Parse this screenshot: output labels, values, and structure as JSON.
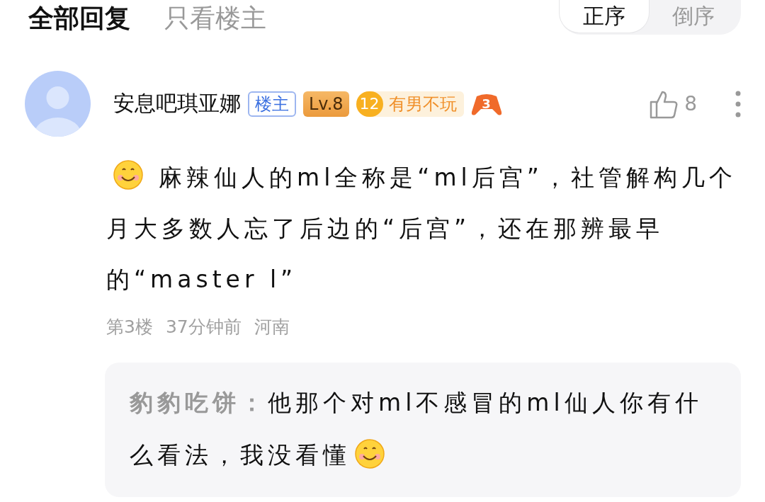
{
  "header": {
    "tabs": [
      {
        "label": "全部回复",
        "selected": true
      },
      {
        "label": "只看楼主",
        "selected": false
      }
    ],
    "sort": [
      {
        "label": "正序",
        "selected": true
      },
      {
        "label": "倒序",
        "selected": false
      }
    ]
  },
  "post": {
    "author": "安息吧琪亚娜",
    "badges": [
      {
        "kind": "role",
        "text": "楼主"
      },
      {
        "kind": "level",
        "text": "Lv.8"
      },
      {
        "kind": "fan",
        "number": "12",
        "text": "有男不玩"
      },
      {
        "kind": "game",
        "text": "3"
      }
    ],
    "likes": "8",
    "content": "麻辣仙人的ml全称是“ml后宫”，社管解构几个月大多数人忘了后边的“后宫”，还在那辨最早的“master l”",
    "floor": "第3楼",
    "time": "37分钟前",
    "location": "河南",
    "reply": {
      "author": "豹豹吃饼：",
      "text": "他那个对ml不感冒的ml仙人你有什么看法，我没看懂"
    }
  }
}
